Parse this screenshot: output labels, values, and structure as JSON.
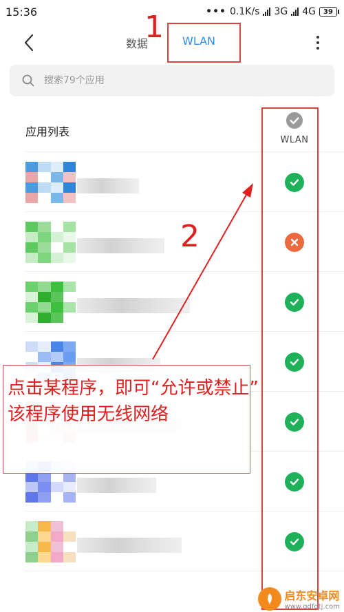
{
  "status_bar": {
    "time": "15:36",
    "dots": "•••",
    "speed": "0.1K/s",
    "net_3g": "3G",
    "net_4g": "4G",
    "battery": "39"
  },
  "header": {
    "tab_data": "数据",
    "tab_wlan": "WLAN"
  },
  "search": {
    "placeholder": "搜索79个应用"
  },
  "list": {
    "title": "应用列表",
    "column_label": "WLAN",
    "rows": [
      {
        "status": "allowed",
        "icon": "app-icon-blurred"
      },
      {
        "status": "denied",
        "icon": "app-icon-blurred"
      },
      {
        "status": "allowed",
        "icon": "app-icon-blurred"
      },
      {
        "status": "allowed",
        "icon": "app-icon-blurred"
      },
      {
        "status": "allowed",
        "icon": "app-icon-blurred"
      },
      {
        "status": "allowed",
        "icon": "app-icon-blurred"
      },
      {
        "status": "allowed",
        "icon": "app-icon-blurred"
      }
    ]
  },
  "annotations": {
    "step1": "1",
    "step2": "2",
    "note_line1": "点击某程序，即可“允许或禁止”",
    "note_line2": "该程序使用无线网络",
    "color": "#e02020"
  },
  "watermark": {
    "name": "启东安卓网",
    "url": "www.qdfdtj.com"
  },
  "colors": {
    "accent": "#2d8cf0",
    "allowed": "#1fb05a",
    "denied": "#ec6a3f"
  }
}
